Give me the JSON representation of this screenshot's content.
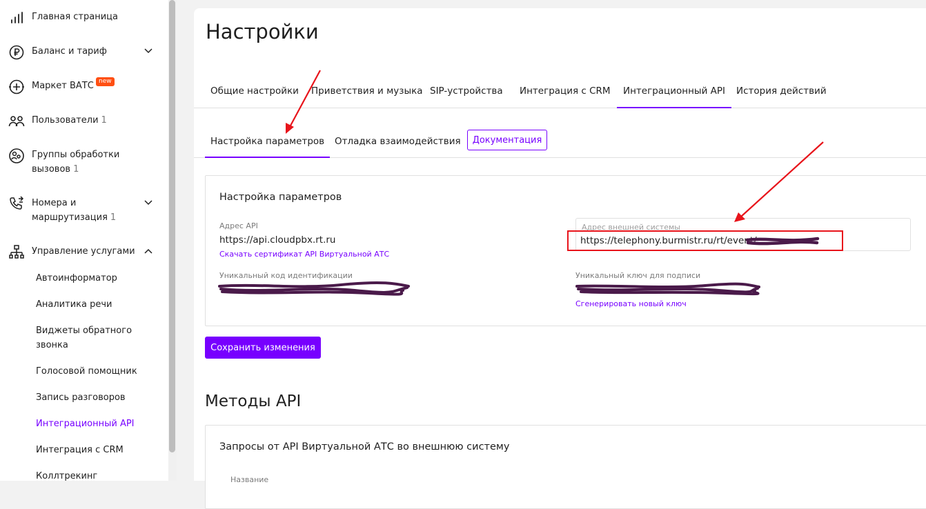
{
  "sidebar": {
    "items": [
      {
        "label": "Главная страница",
        "icon": "bar-chart-icon"
      },
      {
        "label": "Баланс и тариф",
        "icon": "ruble-icon"
      },
      {
        "label": "Маркет ВАТС",
        "icon": "market-icon",
        "badge": "new"
      },
      {
        "label": "Пользователи",
        "count": "1",
        "icon": "users-icon"
      },
      {
        "label": "Группы обработки вызовов",
        "count": "1",
        "icon": "call-group-icon"
      },
      {
        "label": "Номера и маршрутизация",
        "count": "1",
        "icon": "phone-routing-icon"
      },
      {
        "label": "Управление услугами",
        "icon": "services-icon"
      }
    ],
    "sub_items": [
      {
        "label": "Автоинформатор"
      },
      {
        "label": "Аналитика речи"
      },
      {
        "label": "Виджеты обратного звонка"
      },
      {
        "label": "Голосовой помощник"
      },
      {
        "label": "Запись разговоров"
      },
      {
        "label": "Интеграционный API",
        "active": true
      },
      {
        "label": "Интеграция с CRM"
      },
      {
        "label": "Коллтрекинг"
      }
    ]
  },
  "page": {
    "title": "Настройки",
    "tabs": [
      {
        "label": "Общие настройки"
      },
      {
        "label": "Приветствия и музыка"
      },
      {
        "label": "SIP-устройства"
      },
      {
        "label": "Интеграция с CRM"
      },
      {
        "label": "Интеграционный API",
        "active": true
      },
      {
        "label": "История действий"
      }
    ],
    "subtabs": [
      {
        "label": "Настройка параметров",
        "active": true
      },
      {
        "label": "Отладка взаимодействия"
      }
    ],
    "doc_button": "Документация"
  },
  "params": {
    "title": "Настройка параметров",
    "api_address_label": "Адрес API",
    "api_address_value": "https://api.cloudpbx.rt.ru",
    "download_cert_link": "Скачать сертификат API Виртуальной АТС",
    "external_address_label": "Адрес внешней системы",
    "external_address_value": "https://telephony.burmistr.ru/rt/event/",
    "unique_id_label": "Уникальный код идентификации",
    "sign_key_label": "Уникальный ключ для подписи",
    "generate_key_link": "Сгенерировать новый ключ",
    "save_button": "Сохранить изменения"
  },
  "methods": {
    "title": "Методы API",
    "panel_title": "Запросы от API Виртуальной АТС во внешнюю систему",
    "name_label": "Название"
  },
  "colors": {
    "accent": "#7700ff",
    "badge": "#ff4f12",
    "annotation": "#e8141b",
    "redaction": "#4a1a4a"
  }
}
